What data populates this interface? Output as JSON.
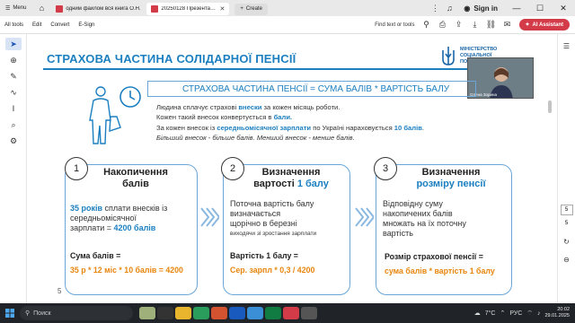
{
  "browser": {
    "menu_label": "Menu",
    "tabs": [
      {
        "title": "одним файлом вся книга О.Н."
      },
      {
        "title": "20250128 Презентація ..."
      }
    ],
    "create_label": "Create",
    "signin_label": "Sign in"
  },
  "toolbar": {
    "items": [
      "All tools",
      "Edit",
      "Convert",
      "E-Sign"
    ],
    "find_label": "Find text or tools",
    "ai_label": "AI Assistant"
  },
  "slide": {
    "title": "СТРАХОВА ЧАСТИНА СОЛІДАРНОЇ ПЕНСІЇ",
    "ministry": "МІНІСТЕРСТВО СОЦІАЛЬНОЇ ПОЛІТИКИ УКРАЇНИ",
    "video_name": "Олена Зорина",
    "formula": "СТРАХОВА ЧАСТИНА ПЕНСІЇ = СУМА БАЛІВ * ВАРТІСТЬ БАЛУ",
    "desc": {
      "l1_a": "Людина сплачує страхові ",
      "l1_b": "внески",
      "l1_c": " за кожен місяць роботи.",
      "l2_a": "Кожен такий внесок конвертується в ",
      "l2_b": "бали.",
      "l3_a": "За кожен внесок із ",
      "l3_b": "середньомісячної зарплати",
      "l3_c": " по Україні нараховується ",
      "l3_d": "10 балів",
      "l3_e": ".",
      "l4": "Більший внесок - більше балів. Менший внесок - менше балів."
    },
    "cards": [
      {
        "num": "1",
        "heading_l1": "Накопичення",
        "heading_l2": "балів",
        "t1_b": "35 років",
        "t1_a": " сплати внесків із",
        "t2": "середньомісячної",
        "t3_a": "зарплати = ",
        "t3_b": "4200 балів",
        "formula": "Сума балів =",
        "orange": "35 р * 12 міс * 10 балів = 4200"
      },
      {
        "num": "2",
        "heading_l1": "Визначення",
        "heading_l2_a": "вартості ",
        "heading_l2_b": "1 балу",
        "t1": "Поточна вартість балу",
        "t2": "визначається",
        "t3": "щорічно в березні",
        "t4": "виходячи зі зростання зарплати",
        "formula": "Вартість 1 балу =",
        "orange": "Сер. зарпл * 0,3 / 4200"
      },
      {
        "num": "3",
        "heading_l1": "Визначення",
        "heading_l2": "розміру пенсії",
        "t1": "Відповідну суму",
        "t2": "накопичених балів",
        "t3": "множать на їх поточну",
        "t4": "вартість",
        "formula": "Розмір страхової пенсії  =",
        "orange": "сума балів * вартість 1 балу"
      }
    ],
    "page_number": "5"
  },
  "rightrail": {
    "page_current": "5",
    "page_total": "5"
  },
  "taskbar": {
    "search_label": "Поиск",
    "weather": "7°C",
    "lang": "РУС",
    "time": "20:02",
    "date": "29.01.2025"
  },
  "colors": {
    "accent_blue": "#1b7fc0",
    "orange": "#e8850c",
    "ai_red": "#d33b48"
  }
}
